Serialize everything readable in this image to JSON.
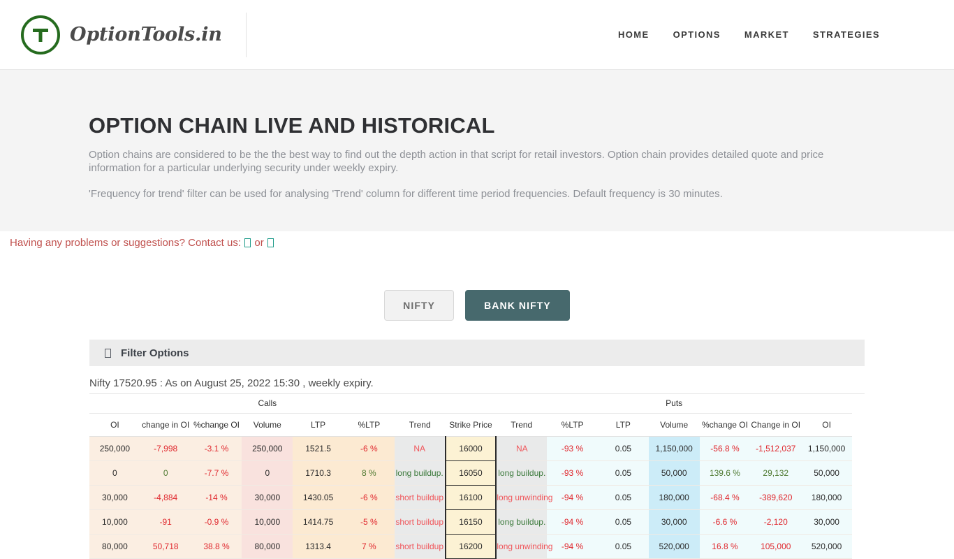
{
  "navbar": {
    "brand_name": "OptionTools.in",
    "logo_icon": "circle-t-logo-icon",
    "links": [
      {
        "label": "HOME"
      },
      {
        "label": "OPTIONS"
      },
      {
        "label": "MARKET"
      },
      {
        "label": "STRATEGIES"
      }
    ]
  },
  "hero": {
    "title": "OPTION CHAIN LIVE AND HISTORICAL",
    "paragraph1": "Option chains are considered to be the the best way to find out the depth action in that script for retail investors. Option chain provides detailed quote and price information for a particular underlying security under weekly expiry.",
    "paragraph2": "'Frequency for trend' filter can be used for analysing 'Trend' column for different time period frequencies. Default frequency is 30 minutes."
  },
  "contact": {
    "text_before": "Having any problems or suggestions? Contact us:",
    "separator": "or",
    "icon1": "missing-glyph-icon",
    "icon2": "missing-glyph-icon"
  },
  "tabs": {
    "items": [
      {
        "label": "NIFTY",
        "active": false
      },
      {
        "label": "BANK NIFTY",
        "active": true
      }
    ]
  },
  "filter": {
    "icon": "filter-glyph-icon",
    "label": "Filter Options"
  },
  "status": {
    "text": "Nifty 17520.95 : As on August 25, 2022 15:30 , weekly expiry."
  },
  "table": {
    "group_headers": [
      {
        "label": "Calls",
        "span": 7
      },
      {
        "label": "",
        "span": 1
      },
      {
        "label": "Puts",
        "span": 7
      }
    ],
    "columns": [
      {
        "label": "OI",
        "cls": "c-oi"
      },
      {
        "label": "change in OI",
        "cls": "c-coi"
      },
      {
        "label": "%change OI",
        "cls": "c-pcoi"
      },
      {
        "label": "Volume",
        "cls": "c-vol"
      },
      {
        "label": "LTP",
        "cls": "c-ltp"
      },
      {
        "label": "%LTP",
        "cls": "c-pltp"
      },
      {
        "label": "Trend",
        "cls": "c-trend"
      },
      {
        "label": "Strike Price",
        "cls": "c-strike"
      },
      {
        "label": "Trend",
        "cls": "p-trend"
      },
      {
        "label": "%LTP",
        "cls": "p-pltp"
      },
      {
        "label": "LTP",
        "cls": "p-ltp"
      },
      {
        "label": "Volume",
        "cls": "p-vol"
      },
      {
        "label": "%change OI",
        "cls": "p-pcoi"
      },
      {
        "label": "Change in OI",
        "cls": "p-coi"
      },
      {
        "label": "OI",
        "cls": "p-oi"
      }
    ],
    "rows": [
      {
        "call_oi": "250,000",
        "call_coi": "-7,998",
        "call_coi_sign": "neg",
        "call_pcoi": "-3.1 %",
        "call_pcoi_sign": "neg",
        "call_volume": "250,000",
        "call_ltp": "1521.5",
        "call_pltp": "-6 %",
        "call_pltp_sign": "neg",
        "call_trend": "NA",
        "call_trend_sign": "na",
        "strike": "16000",
        "put_trend": "NA",
        "put_trend_sign": "na",
        "put_pltp": "-93 %",
        "put_pltp_sign": "neg",
        "put_ltp": "0.05",
        "put_volume": "1,150,000",
        "put_pcoi": "-56.8 %",
        "put_pcoi_sign": "neg",
        "put_coi": "-1,512,037",
        "put_coi_sign": "neg",
        "put_oi": "1,150,000"
      },
      {
        "call_oi": "0",
        "call_coi": "0",
        "call_coi_sign": "pos",
        "call_pcoi": "-7.7 %",
        "call_pcoi_sign": "neg",
        "call_volume": "0",
        "call_ltp": "1710.3",
        "call_pltp": "8 %",
        "call_pltp_sign": "pos",
        "call_trend": "long buildup.",
        "call_trend_sign": "trend-up",
        "strike": "16050",
        "put_trend": "long buildup.",
        "put_trend_sign": "trend-up",
        "put_pltp": "-93 %",
        "put_pltp_sign": "neg",
        "put_ltp": "0.05",
        "put_volume": "50,000",
        "put_pcoi": "139.6 %",
        "put_pcoi_sign": "pos",
        "put_coi": "29,132",
        "put_coi_sign": "pos",
        "put_oi": "50,000"
      },
      {
        "call_oi": "30,000",
        "call_coi": "-4,884",
        "call_coi_sign": "neg",
        "call_pcoi": "-14 %",
        "call_pcoi_sign": "neg",
        "call_volume": "30,000",
        "call_ltp": "1430.05",
        "call_pltp": "-6 %",
        "call_pltp_sign": "neg",
        "call_trend": "short buildup",
        "call_trend_sign": "trend-down",
        "strike": "16100",
        "put_trend": "long unwinding",
        "put_trend_sign": "trend-down",
        "put_pltp": "-94 %",
        "put_pltp_sign": "neg",
        "put_ltp": "0.05",
        "put_volume": "180,000",
        "put_pcoi": "-68.4 %",
        "put_pcoi_sign": "neg",
        "put_coi": "-389,620",
        "put_coi_sign": "neg",
        "put_oi": "180,000"
      },
      {
        "call_oi": "10,000",
        "call_coi": "-91",
        "call_coi_sign": "neg",
        "call_pcoi": "-0.9 %",
        "call_pcoi_sign": "neg",
        "call_volume": "10,000",
        "call_ltp": "1414.75",
        "call_pltp": "-5 %",
        "call_pltp_sign": "neg",
        "call_trend": "short buildup",
        "call_trend_sign": "trend-down",
        "strike": "16150",
        "put_trend": "long buildup.",
        "put_trend_sign": "trend-up",
        "put_pltp": "-94 %",
        "put_pltp_sign": "neg",
        "put_ltp": "0.05",
        "put_volume": "30,000",
        "put_pcoi": "-6.6 %",
        "put_pcoi_sign": "neg",
        "put_coi": "-2,120",
        "put_coi_sign": "neg",
        "put_oi": "30,000"
      },
      {
        "call_oi": "80,000",
        "call_coi": "50,718",
        "call_coi_sign": "neg",
        "call_pcoi": "38.8 %",
        "call_pcoi_sign": "neg",
        "call_volume": "80,000",
        "call_ltp": "1313.4",
        "call_pltp": "7 %",
        "call_pltp_sign": "neg",
        "call_trend": "short buildup",
        "call_trend_sign": "trend-down",
        "strike": "16200",
        "put_trend": "long unwinding",
        "put_trend_sign": "trend-down",
        "put_pltp": "-94 %",
        "put_pltp_sign": "neg",
        "put_ltp": "0.05",
        "put_volume": "520,000",
        "put_pcoi": "16.8 %",
        "put_pcoi_sign": "neg",
        "put_coi": "105,000",
        "put_coi_sign": "neg",
        "put_oi": "520,000"
      }
    ]
  }
}
